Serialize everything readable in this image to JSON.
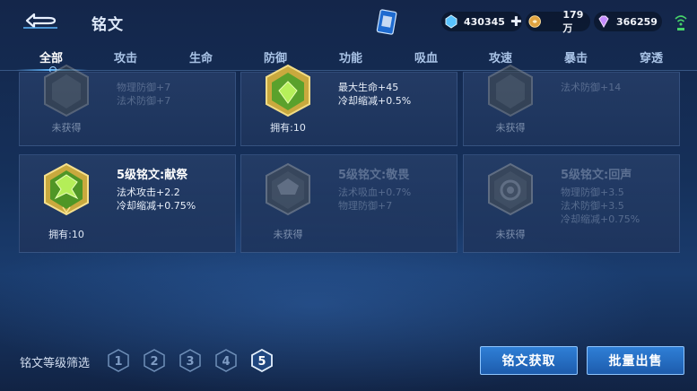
{
  "header": {
    "title": "铭文",
    "currencies": {
      "diamond": "430345",
      "gold": "179万",
      "gem": "366259"
    }
  },
  "tabs": [
    {
      "label": "全部",
      "active": true
    },
    {
      "label": "攻击",
      "active": false
    },
    {
      "label": "生命",
      "active": false
    },
    {
      "label": "防御",
      "active": false
    },
    {
      "label": "功能",
      "active": false
    },
    {
      "label": "吸血",
      "active": false
    },
    {
      "label": "攻速",
      "active": false
    },
    {
      "label": "暴击",
      "active": false
    },
    {
      "label": "穿透",
      "active": false
    }
  ],
  "cards_row1": [
    {
      "stats": [
        "物理防御+7",
        "法术防御+7"
      ],
      "owned": "未获得",
      "obtained": false
    },
    {
      "stats": [
        "最大生命+45",
        "冷却缩减+0.5%"
      ],
      "owned": "拥有:10",
      "obtained": true
    },
    {
      "stats": [
        "法术防御+14"
      ],
      "owned": "未获得",
      "obtained": false
    }
  ],
  "cards_row2": [
    {
      "title": "5级铭文:献祭",
      "stats": [
        "法术攻击+2.2",
        "冷却缩减+0.75%"
      ],
      "owned": "拥有:10",
      "obtained": true
    },
    {
      "title": "5级铭文:敬畏",
      "stats": [
        "法术吸血+0.7%",
        "物理防御+7"
      ],
      "owned": "未获得",
      "obtained": false
    },
    {
      "title": "5级铭文:回声",
      "stats": [
        "物理防御+3.5",
        "法术防御+3.5",
        "冷却缩减+0.75%"
      ],
      "owned": "未获得",
      "obtained": false
    }
  ],
  "footer": {
    "filter_label": "铭文等级筛选",
    "levels": [
      "1",
      "2",
      "3",
      "4",
      "5"
    ],
    "selected_level": "5",
    "get_button": "铭文获取",
    "sell_button": "批量出售"
  },
  "colors": {
    "accent": "#5fb8ff",
    "button": "#1d5cad",
    "badge_green": "#8fd13a",
    "badge_gold": "#e2c25a"
  }
}
